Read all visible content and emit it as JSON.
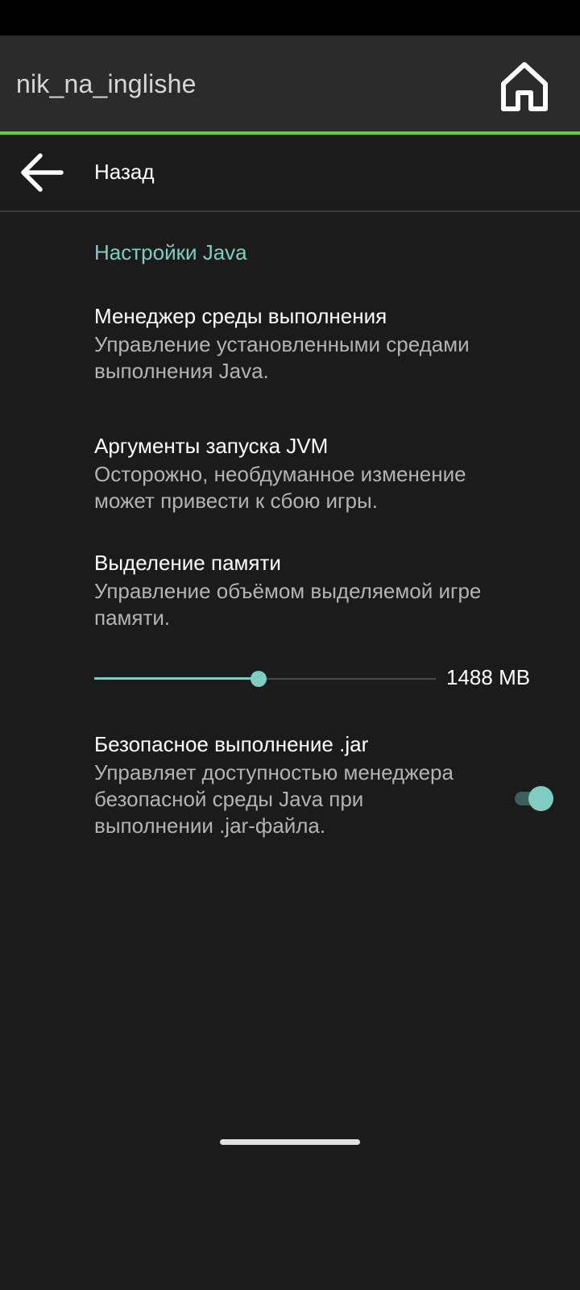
{
  "app": {
    "title": "nik_na_inglishe"
  },
  "icons": {
    "home": "home-icon",
    "back": "arrow-back-icon"
  },
  "colors": {
    "accent_line": "#5cd13a",
    "teal_accent": "#7fcdc2",
    "background": "#1b1b1b",
    "app_bar": "#2b2b2b"
  },
  "nav": {
    "back_label": "Назад"
  },
  "settings": {
    "section_title": "Настройки Java",
    "runtime_manager": {
      "title": "Менеджер среды выполнения",
      "summary": "Управление установленными средами выполнения Java."
    },
    "jvm_args": {
      "title": "Аргументы запуска JVM",
      "summary": "Осторожно, необдуманное изменение может привести к сбою игры."
    },
    "memory": {
      "title": "Выделение памяти",
      "summary": "Управление объёмом выделяемой игре памяти.",
      "value_label": "1488 MB",
      "slider_fraction": 0.48
    },
    "jar_safe": {
      "title": "Безопасное выполнение .jar",
      "summary": "Управляет доступностью менеджера безопасной среды Java при выполнении .jar-файла.",
      "enabled": true
    }
  }
}
